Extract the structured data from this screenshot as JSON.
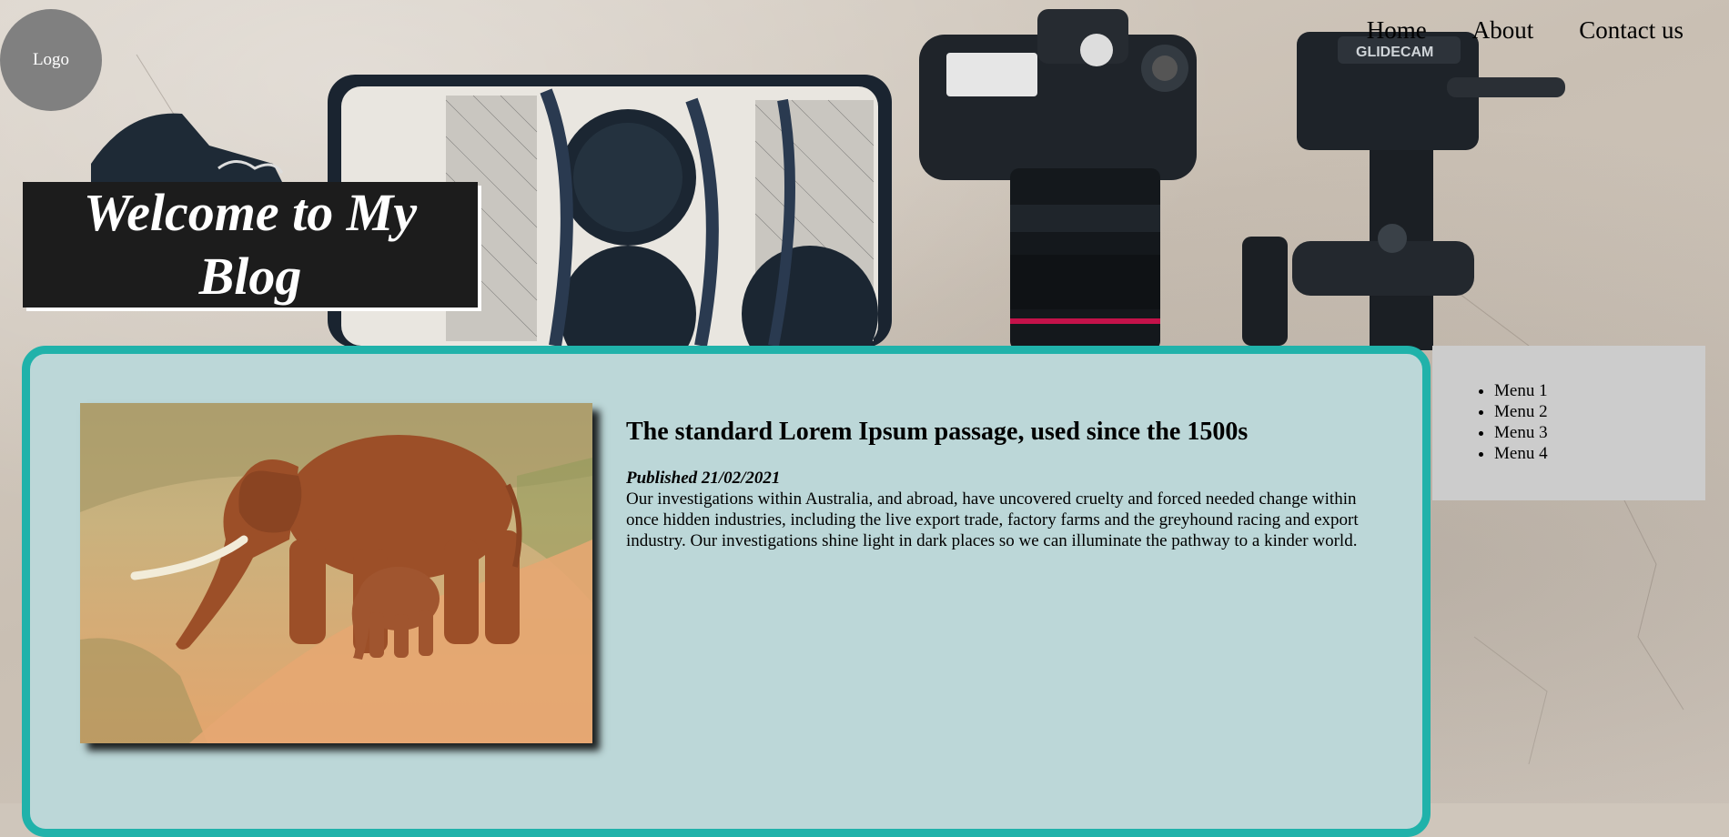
{
  "header": {
    "logo_text": "Logo",
    "nav": [
      {
        "label": "Home"
      },
      {
        "label": "About"
      },
      {
        "label": "Contact us"
      }
    ]
  },
  "hero": {
    "title_line1": "Welcome to My",
    "title_line2": "Blog"
  },
  "article": {
    "image_icon": "elephant-photo",
    "title": "The standard Lorem Ipsum passage, used since the 1500s",
    "published": "Published 21/02/2021",
    "body": "Our investigations within Australia, and abroad, have uncovered cruelty and forced needed change within once hidden industries, including the live export trade, factory farms and the greyhound racing and export industry. Our investigations shine light in dark places so we can illuminate the pathway to a kinder world."
  },
  "sidebar": {
    "items": [
      {
        "label": "Menu 1"
      },
      {
        "label": "Menu 2"
      },
      {
        "label": "Menu 3"
      },
      {
        "label": "Menu 4"
      }
    ]
  },
  "colors": {
    "card_bg": "#bcd7d8",
    "card_border": "#20b2aa",
    "sidebar_bg": "#cccccc",
    "logo_bg": "#808080",
    "hero_bg": "#1c1c1c"
  }
}
